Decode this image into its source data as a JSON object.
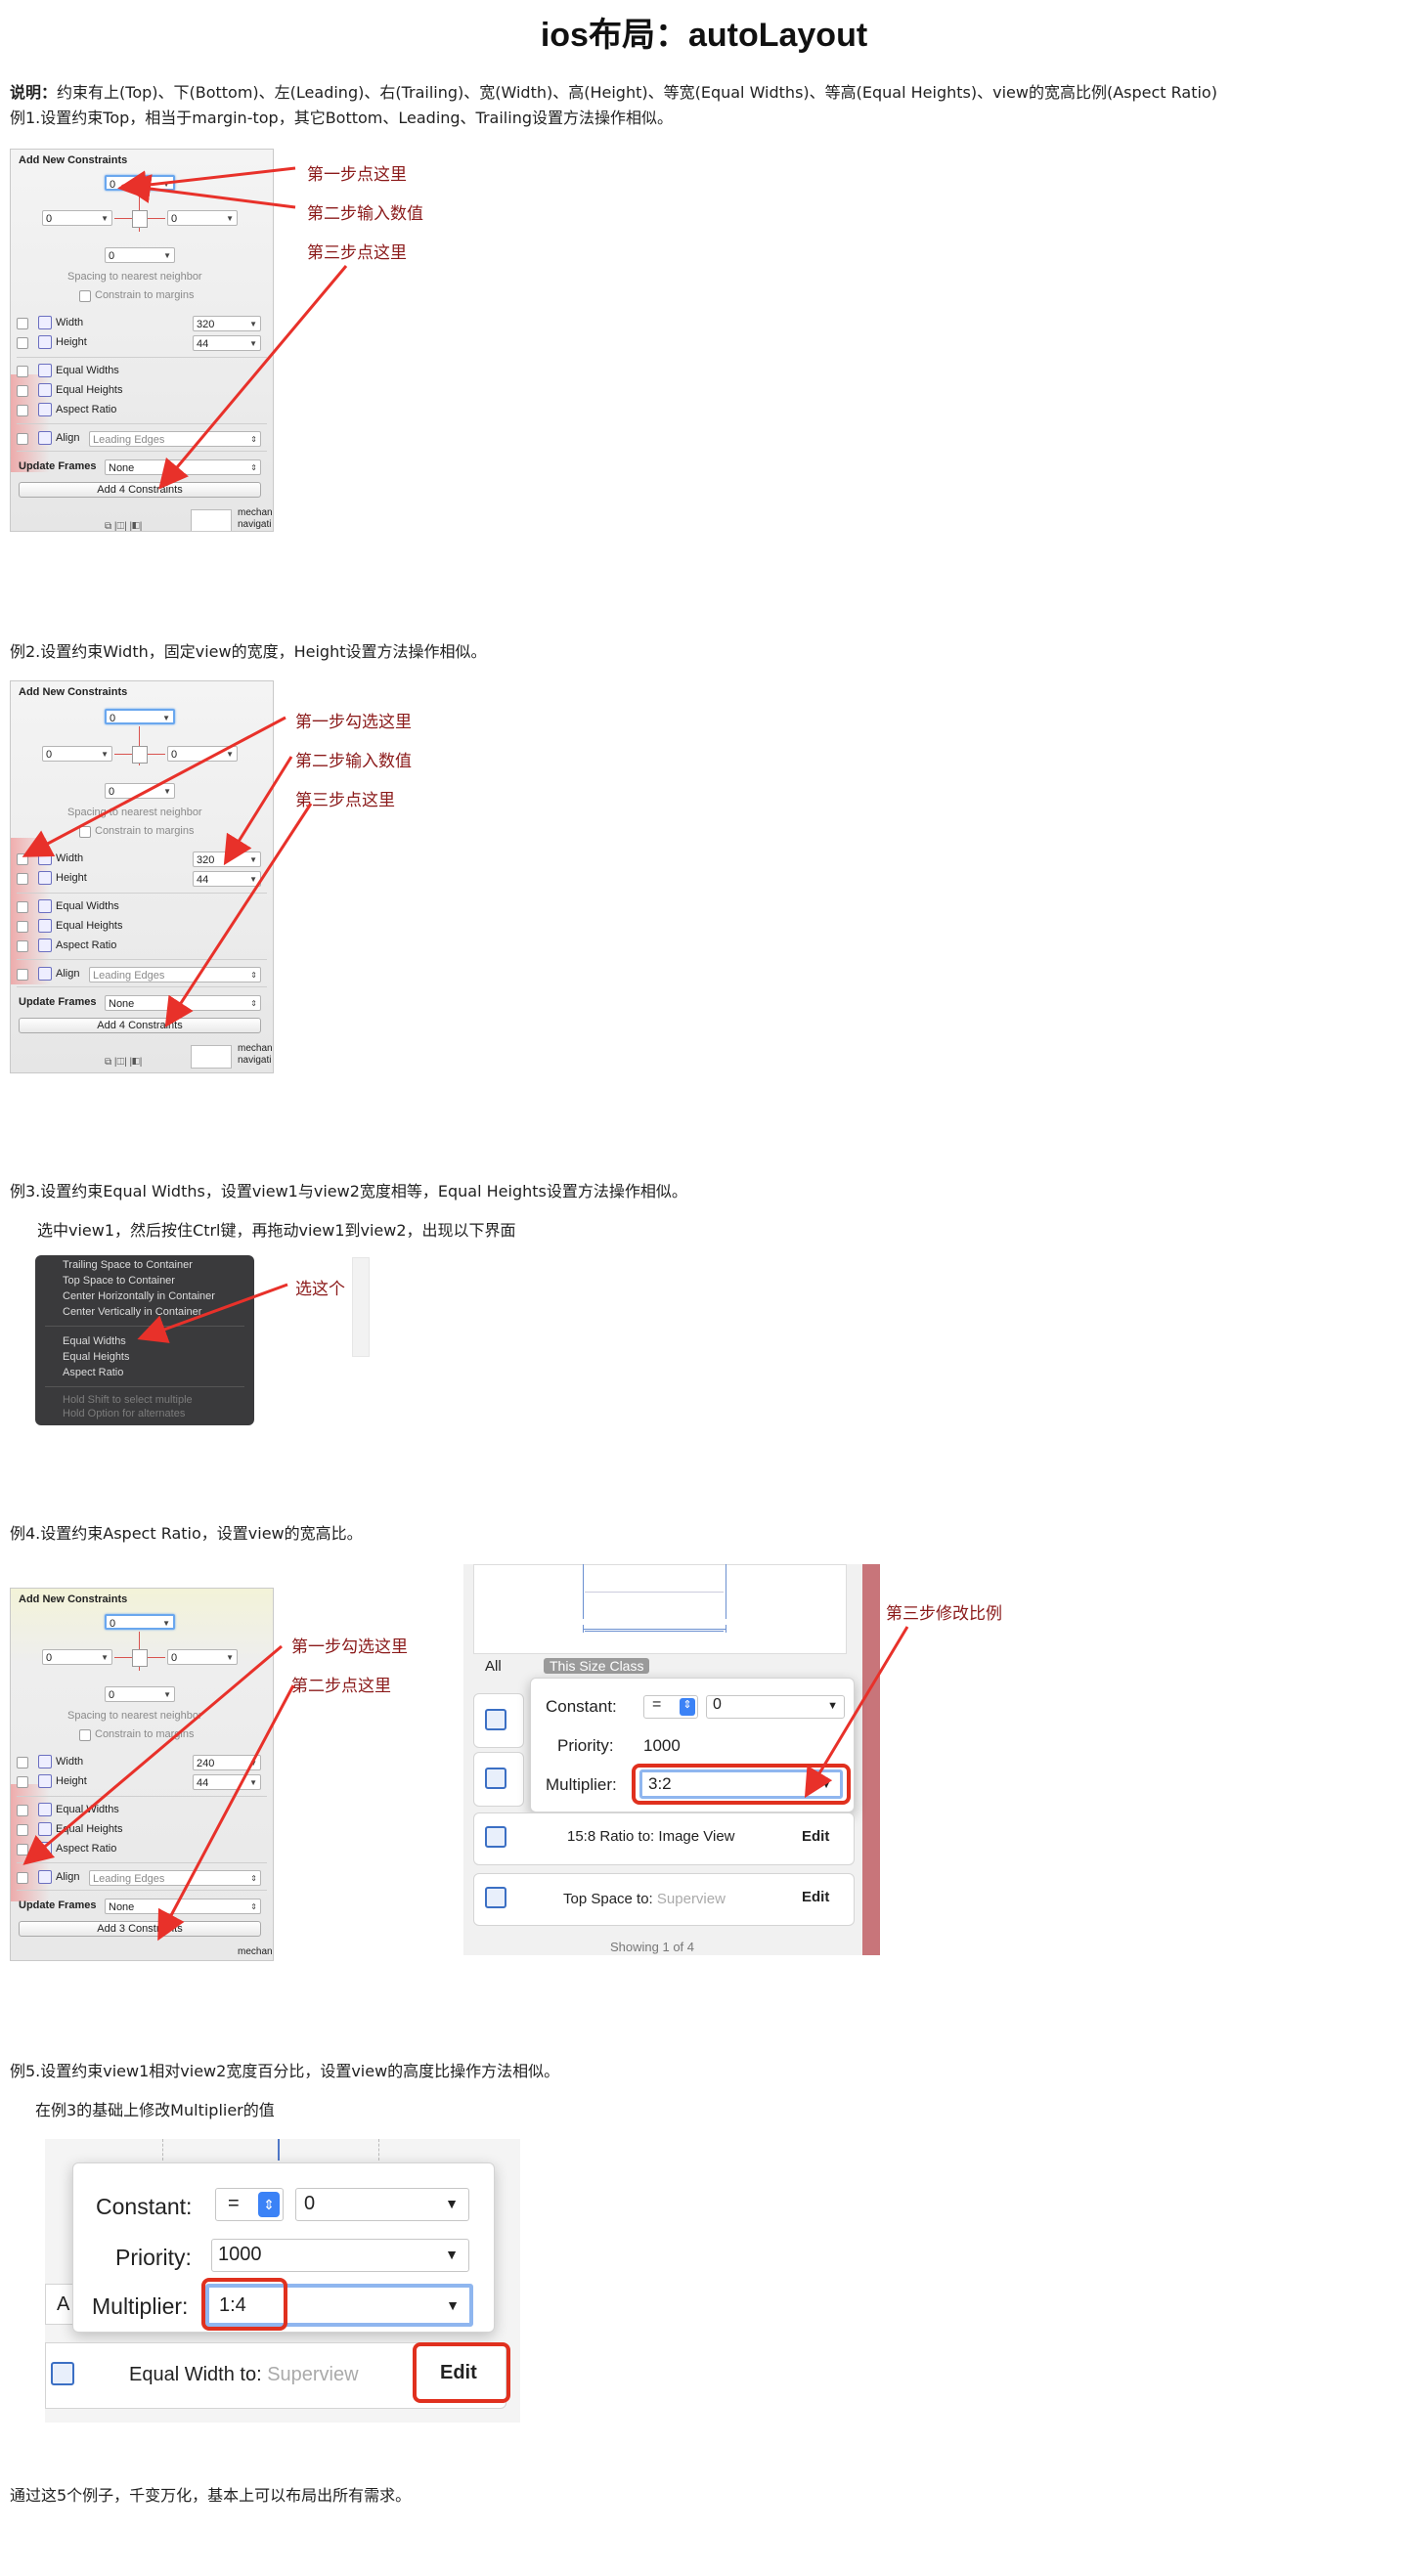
{
  "title": "ios布局：autoLayout",
  "intro": {
    "label": "说明：",
    "text": "约束有上(Top)、下(Bottom)、左(Leading)、右(Trailing)、宽(Width)、高(Height)、等宽(Equal Widths)、等高(Equal Heights)、view的宽高比例(Aspect Ratio)"
  },
  "examples": [
    {
      "heading": "例1.设置约束Top，相当于margin-top，其它Bottom、Leading、Trailing设置方法操作相似。",
      "annotations": [
        "第一步点这里",
        "第二步输入数值",
        "第三步点这里"
      ]
    },
    {
      "heading": "例2.设置约束Width，固定view的宽度，Height设置方法操作相似。",
      "annotations": [
        "第一步勾选这里",
        "第二步输入数值",
        "第三步点这里"
      ]
    },
    {
      "heading": "例3.设置约束Equal Widths，设置view1与view2宽度相等，Equal Heights设置方法操作相似。",
      "subtext": "选中view1，然后按住Ctrl键，再拖动view1到view2，出现以下界面",
      "annotations": [
        "选这个"
      ]
    },
    {
      "heading": "例4.设置约束Aspect Ratio，设置view的宽高比。",
      "annotations": [
        "第一步勾选这里",
        "第二步点这里",
        "第三步修改比例"
      ]
    },
    {
      "heading": "例5.设置约束view1相对view2宽度百分比，设置view的高度比操作方法相似。",
      "subtext": "在例3的基础上修改Multiplier的值"
    }
  ],
  "footer": "通过这5个例子，千变万化，基本上可以布局出所有需求。",
  "panel": {
    "header": "Add New Constraints",
    "top_value": "0",
    "left_value": "0",
    "right_value": "0",
    "bottom_value": "0",
    "spacing_label": "Spacing to nearest neighbor",
    "margins_label": "Constrain to margins",
    "width_label": "Width",
    "height_label": "Height",
    "width_value": "320",
    "height_value": "44",
    "equal_widths": "Equal Widths",
    "equal_heights": "Equal Heights",
    "aspect_ratio": "Aspect Ratio",
    "align_label": "Align",
    "align_value": "Leading Edges",
    "update_frames_label": "Update Frames",
    "update_frames_value": "None",
    "add_button": "Add 4 Constraints",
    "add_button_ex4": "Add 3 Constraints",
    "width_value_ex4": "240",
    "side_text": [
      "mechan",
      "navigati"
    ]
  },
  "context_menu": {
    "items_top": [
      "Trailing Space to Container",
      "Top Space to Container",
      "Center Horizontally in Container",
      "Center Vertically in Container"
    ],
    "items_mid": [
      "Equal Widths",
      "Equal Heights",
      "Aspect Ratio"
    ],
    "items_bottom": [
      "Hold Shift to select multiple",
      "Hold Option for alternates"
    ]
  },
  "inspector4": {
    "tab_all": "All",
    "tab_size_class": "This Size Class",
    "constant_label": "Constant:",
    "relation": "=",
    "constant_value": "0",
    "priority_label": "Priority:",
    "priority_value": "1000",
    "multiplier_label": "Multiplier:",
    "multiplier_value": "3:2",
    "row1": "15:8 Ratio to:",
    "row1_target": "Image View",
    "row2": "Top Space to:",
    "row2_target": "Superview",
    "edit": "Edit",
    "bottom_text": "Showing 1 of 4"
  },
  "inspector5": {
    "constant_label": "Constant:",
    "relation": "=",
    "constant_value": "0",
    "priority_label": "Priority:",
    "priority_value": "1000",
    "multiplier_label": "Multiplier:",
    "multiplier_value": "1:4",
    "row_label": "Equal Width to:",
    "row_target": "Superview",
    "edit": "Edit",
    "cut_letter": "A"
  },
  "colors": {
    "annotation": "#8b1a1a",
    "arrow": "#e8312a",
    "highlight": "#e0301e"
  }
}
